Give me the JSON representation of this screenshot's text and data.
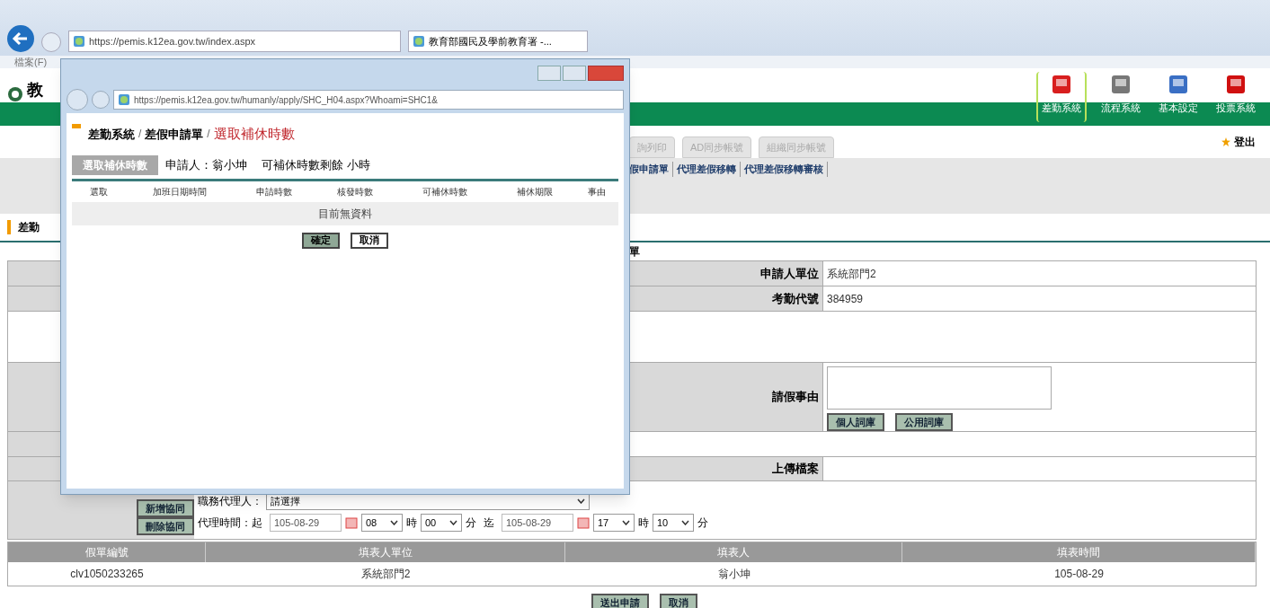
{
  "browser": {
    "address": "https://pemis.k12ea.gov.tw/index.aspx",
    "tab_title": "教育部國民及學前教育署 -...",
    "menu_fragment": "檔案(F)"
  },
  "header": {
    "logo_fragment": "教",
    "systems": [
      {
        "label": "差勤系統",
        "selected": true
      },
      {
        "label": "流程系統",
        "selected": false
      },
      {
        "label": "基本設定",
        "selected": false
      },
      {
        "label": "投票系統",
        "selected": false
      }
    ],
    "tabs": [
      "詢列印",
      "AD同步帳號",
      "組織同步帳號"
    ],
    "logout": "登出",
    "sub_links": [
      "假申請單",
      "代理差假移轉",
      "代理差假移轉審核"
    ]
  },
  "page": {
    "title_fragment": "差勤",
    "form_title_fragment": "單"
  },
  "form": {
    "rows": [
      {
        "kind": "field",
        "label": "申請人單位",
        "value": "系統部門2"
      },
      {
        "kind": "field",
        "label": "考勤代號",
        "value": "384959"
      },
      {
        "kind": "blank"
      },
      {
        "kind": "textarea",
        "label": "請假事由",
        "buttons": [
          "個人詞庫",
          "公用詞庫"
        ]
      },
      {
        "kind": "spacer"
      },
      {
        "kind": "upload",
        "label": "上傳檔案"
      }
    ]
  },
  "agent": {
    "buttons": [
      "新增協同",
      "刪除協同"
    ],
    "agent_label": "職務代理人：",
    "agent_select": "請選擇",
    "time_label": "代理時間：起",
    "to_label": "迄",
    "start": {
      "date": "105-08-29",
      "hour": "08",
      "hour_unit": "時",
      "minute": "00",
      "minute_unit": "分"
    },
    "end": {
      "date": "105-08-29",
      "hour": "17",
      "hour_unit": "時",
      "minute": "10",
      "minute_unit": "分"
    }
  },
  "records": {
    "columns": [
      "假單編號",
      "填表人單位",
      "填表人",
      "填表時間"
    ],
    "rows": [
      [
        "clv1050233265",
        "系統部門2",
        "翁小坤",
        "105-08-29"
      ]
    ]
  },
  "actions": [
    "送出申請",
    "取消"
  ],
  "popup": {
    "address": "https://pemis.k12ea.gov.tw/humanly/apply/SHC_H04.aspx?Whoami=SHC1&",
    "breadcrumb": [
      "差勤系統",
      "差假申請單"
    ],
    "separator": "/",
    "current": "選取補休時數",
    "tab": {
      "label": "選取補休時數",
      "selected": true
    },
    "applicant": "申請人：翁小坤",
    "remaining": "可補休時數剩餘 小時",
    "columns": [
      "選取",
      "加班日期時間",
      "申請時數",
      "核發時數",
      "可補休時數",
      "補休期限",
      "事由"
    ],
    "empty": "目前無資料",
    "buttons": [
      "確定",
      "取消"
    ]
  }
}
